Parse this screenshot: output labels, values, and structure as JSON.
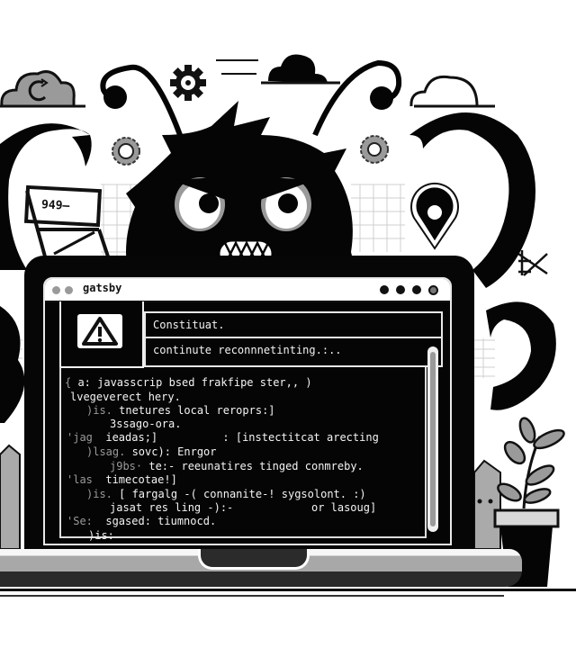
{
  "illustration": {
    "description": "Angry fuzzy bug monster peeking over a laptop showing a terminal error",
    "palette": {
      "background": "#ffffff",
      "ink": "#050505",
      "mid_gray": "#9a9a9a",
      "light_gray": "#d0d0d0",
      "screen_text": "#f4f4f4"
    },
    "sign_text": "949–"
  },
  "terminal_window": {
    "title": "gatsby",
    "alert_icon": "warning-triangle-icon",
    "message_title": "Constituat.",
    "message_status": "continute reconnnetinting.:..",
    "console_lines": [
      {
        "prefix": "{ ",
        "text": "a: javasscrip bsed frakfipe ster,, )"
      },
      {
        "prefix": "",
        "text": "lvegeverect hery."
      },
      {
        "prefix": ")is. ",
        "text": "tnetures local reroprs:]"
      },
      {
        "prefix": "",
        "text": "3ssago-ora."
      },
      {
        "prefix": "'jag  ",
        "text": "ieadas;]          : [instectitcat arecting"
      },
      {
        "prefix": ")lsag. ",
        "text": "sovc): Enrgor"
      },
      {
        "prefix": "j9bs· ",
        "text": "te:- reeunatires tinged conmreby."
      },
      {
        "prefix": "'las  ",
        "text": "timecotae!]"
      },
      {
        "prefix": ")is. ",
        "text": "[ fargalg -( connanite-! sygsolont. :)"
      },
      {
        "prefix": "",
        "text": "jasat res ling -):-            or lasoug]"
      },
      {
        "prefix": "'Se:  ",
        "text": "sgased: tiumnocd."
      },
      {
        "prefix": "",
        "text": ")is:"
      }
    ]
  }
}
